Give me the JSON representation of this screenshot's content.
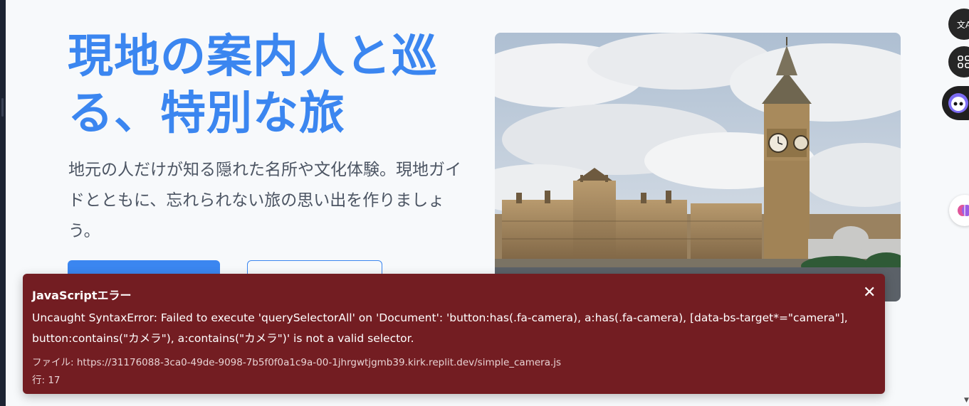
{
  "hero": {
    "title": "現地の案内人と巡る、特別な旅",
    "subtitle": "地元の人だけが知る隠れた名所や文化体験。現地ガイドとともに、忘れられない旅の思い出を作りましょう。"
  },
  "buttons": {
    "primary_label": "",
    "secondary_label": ""
  },
  "side_tools": {
    "translate_glyph": "文A",
    "apps_glyph": "⌘"
  },
  "error": {
    "title": "JavaScriptエラー",
    "message": "Uncaught SyntaxError: Failed to execute 'querySelectorAll' on 'Document': 'button:has(.fa-camera), a:has(.fa-camera), [data-bs-target*=\"camera\"], button:contains(\"カメラ\"), a:contains(\"カメラ\")' is not a valid selector.",
    "file": "ファイル: https://31176088-3ca0-49de-9098-7b5f0f0a1c9a-00-1jhrgwtjgmb39.kirk.replit.dev/simple_camera.js",
    "line": "行: 17",
    "close_glyph": "✕"
  },
  "colors": {
    "accent": "#3b86f0",
    "error_bg": "#731d22",
    "page_bg": "#f7f9fb"
  }
}
